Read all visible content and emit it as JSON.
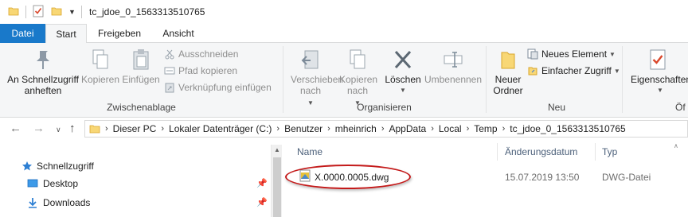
{
  "window": {
    "title": "tc_jdoe_0_1563313510765"
  },
  "tabs": [
    {
      "label": "Datei"
    },
    {
      "label": "Start"
    },
    {
      "label": "Freigeben"
    },
    {
      "label": "Ansicht"
    }
  ],
  "ribbon": {
    "clipboard": {
      "pin_label": "An Schnellzugriff anheften",
      "copy_label": "Kopieren",
      "paste_label": "Einfügen",
      "cut_label": "Ausschneiden",
      "copy_path_label": "Pfad kopieren",
      "paste_shortcut_label": "Verknüpfung einfügen",
      "group_label": "Zwischenablage"
    },
    "organize": {
      "move_label": "Verschieben nach",
      "copy_to_label": "Kopieren nach",
      "delete_label": "Löschen",
      "rename_label": "Umbenennen",
      "group_label": "Organisieren"
    },
    "new": {
      "new_folder_label": "Neuer Ordner",
      "new_item_label": "Neues Element",
      "easy_access_label": "Einfacher Zugriff",
      "group_label": "Neu"
    },
    "open": {
      "properties_label": "Eigenschaften",
      "group_label_partial": "Öf"
    }
  },
  "address": {
    "crumbs": [
      "Dieser PC",
      "Lokaler Datenträger (C:)",
      "Benutzer",
      "mheinrich",
      "AppData",
      "Local",
      "Temp",
      "tc_jdoe_0_1563313510765"
    ]
  },
  "nav_pane": {
    "items": [
      {
        "label": "Schnellzugriff"
      },
      {
        "label": "Desktop"
      },
      {
        "label": "Downloads"
      }
    ]
  },
  "file_list": {
    "columns": {
      "name": "Name",
      "date": "Änderungsdatum",
      "type": "Typ"
    },
    "rows": [
      {
        "name": "X.0000.0005.dwg",
        "date": "15.07.2019 13:50",
        "type": "DWG-Datei"
      }
    ]
  },
  "colors": {
    "file_tab": "#1979ca",
    "highlight_oval": "#c41a1a",
    "folder_yellow": "#f8d775"
  }
}
